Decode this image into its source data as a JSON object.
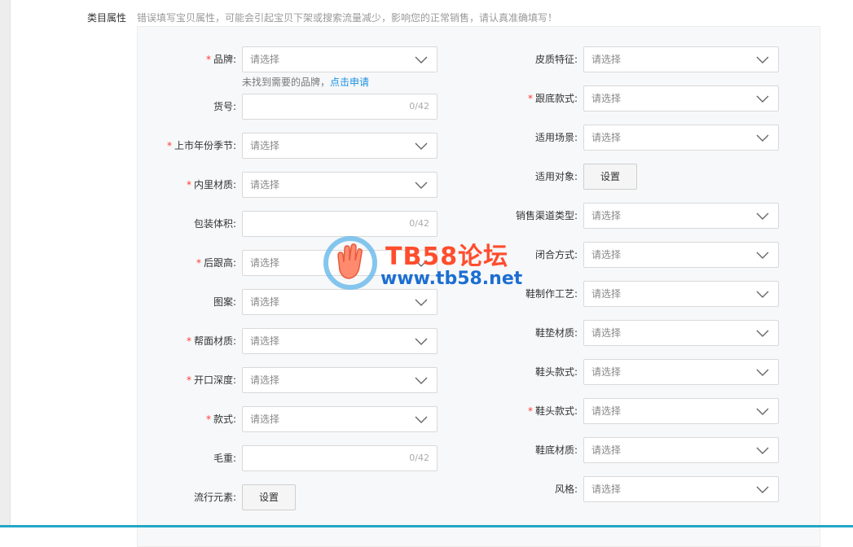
{
  "section": {
    "label": "类目属性",
    "warning": "错误填写宝贝属性，可能会引起宝贝下架或搜索流量减少，影响您的正常销售，请认真准确填写！"
  },
  "hint": {
    "text": "未找到需要的品牌，",
    "link": "点击申请"
  },
  "left_fields": [
    {
      "label": "品牌:",
      "required": true,
      "type": "select",
      "placeholder": "请选择"
    },
    {
      "label": "货号:",
      "required": false,
      "type": "text",
      "counter": "0/42"
    },
    {
      "label": "上市年份季节:",
      "required": true,
      "type": "select",
      "placeholder": "请选择"
    },
    {
      "label": "内里材质:",
      "required": true,
      "type": "select",
      "placeholder": "请选择"
    },
    {
      "label": "包装体积:",
      "required": false,
      "type": "text",
      "counter": "0/42"
    },
    {
      "label": "后跟高:",
      "required": true,
      "type": "select",
      "placeholder": "请选择"
    },
    {
      "label": "图案:",
      "required": false,
      "type": "select",
      "placeholder": "请选择"
    },
    {
      "label": "帮面材质:",
      "required": true,
      "type": "select",
      "placeholder": "请选择"
    },
    {
      "label": "开口深度:",
      "required": true,
      "type": "select",
      "placeholder": "请选择"
    },
    {
      "label": "款式:",
      "required": true,
      "type": "select",
      "placeholder": "请选择"
    },
    {
      "label": "毛重:",
      "required": false,
      "type": "text",
      "counter": "0/42"
    },
    {
      "label": "流行元素:",
      "required": false,
      "type": "button",
      "button_label": "设置"
    }
  ],
  "right_fields": [
    {
      "label": "皮质特征:",
      "required": false,
      "type": "select",
      "placeholder": "请选择"
    },
    {
      "label": "跟底款式:",
      "required": true,
      "type": "select",
      "placeholder": "请选择"
    },
    {
      "label": "适用场景:",
      "required": false,
      "type": "select",
      "placeholder": "请选择"
    },
    {
      "label": "适用对象:",
      "required": false,
      "type": "button",
      "button_label": "设置"
    },
    {
      "label": "销售渠道类型:",
      "required": false,
      "type": "select",
      "placeholder": "请选择"
    },
    {
      "label": "闭合方式:",
      "required": false,
      "type": "select",
      "placeholder": "请选择"
    },
    {
      "label": "鞋制作工艺:",
      "required": false,
      "type": "select",
      "placeholder": "请选择"
    },
    {
      "label": "鞋垫材质:",
      "required": false,
      "type": "select",
      "placeholder": "请选择"
    },
    {
      "label": "鞋头款式:",
      "required": false,
      "type": "select",
      "placeholder": "请选择"
    },
    {
      "label": "鞋头款式:",
      "required": true,
      "type": "select",
      "placeholder": "请选择"
    },
    {
      "label": "鞋底材质:",
      "required": false,
      "type": "select",
      "placeholder": "请选择"
    },
    {
      "label": "风格:",
      "required": false,
      "type": "select",
      "placeholder": "请选择"
    }
  ],
  "watermark": {
    "title": "TB58论坛",
    "url": "www.tb58.net"
  },
  "colors": {
    "required": "#ff3b30",
    "link": "#1a8fe0",
    "accent_bar": "#22a7c6"
  }
}
